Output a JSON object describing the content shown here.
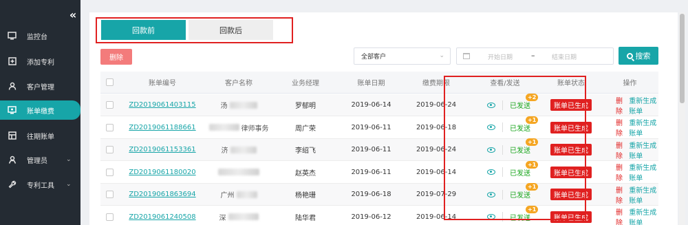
{
  "sidebar": {
    "collapse_icon": "double-chevron-left-icon",
    "items": [
      {
        "label": "监控台",
        "icon": "monitor-icon",
        "active": false,
        "has_children": false
      },
      {
        "label": "添加专利",
        "icon": "plus-square-icon",
        "active": false,
        "has_children": false
      },
      {
        "label": "客户管理",
        "icon": "user-icon",
        "active": false,
        "has_children": false
      },
      {
        "label": "账单缴费",
        "icon": "bill-icon",
        "active": true,
        "has_children": false
      },
      {
        "label": "往期账单",
        "icon": "history-icon",
        "active": false,
        "has_children": false
      },
      {
        "label": "管理员",
        "icon": "admin-icon",
        "active": false,
        "has_children": true
      },
      {
        "label": "专利工具",
        "icon": "wrench-icon",
        "active": false,
        "has_children": true
      }
    ]
  },
  "tabs": [
    {
      "label": "回款前",
      "active": true
    },
    {
      "label": "回款后",
      "active": false
    }
  ],
  "toolbar": {
    "delete_label": "删除",
    "customer_select_value": "全部客户",
    "start_date_placeholder": "开始日期",
    "date_separator": "–",
    "end_date_placeholder": "结束日期",
    "search_label": "搜索"
  },
  "table": {
    "headers": [
      "账单编号",
      "客户名称",
      "业务经理",
      "账单日期",
      "缴费期限",
      "查看/发送",
      "账单状态",
      "操作"
    ],
    "rows": [
      {
        "bill_no": "ZD2019061403115",
        "customer": "汤",
        "manager": "罗郁明",
        "bill_date": "2019-06-14",
        "deadline": "2019-06-24",
        "sent": "已发送",
        "sent_count": "+2",
        "status": "账单已生成"
      },
      {
        "bill_no": "ZD2019061188661",
        "customer": "律师事务",
        "manager": "周广荣",
        "bill_date": "2019-06-11",
        "deadline": "2019-06-18",
        "sent": "已发送",
        "sent_count": "+1",
        "status": "账单已生成"
      },
      {
        "bill_no": "ZD2019061153361",
        "customer": "济",
        "manager": "李绍飞",
        "bill_date": "2019-06-11",
        "deadline": "2019-06-24",
        "sent": "已发送",
        "sent_count": "+1",
        "status": "账单已生成"
      },
      {
        "bill_no": "ZD2019061180020",
        "customer": "",
        "manager": "赵英杰",
        "bill_date": "2019-06-11",
        "deadline": "2019-06-14",
        "sent": "已发送",
        "sent_count": "+1",
        "status": "账单已生成"
      },
      {
        "bill_no": "ZD2019061863694",
        "customer": "广州",
        "manager": "杨艳珊",
        "bill_date": "2019-06-18",
        "deadline": "2019-07-29",
        "sent": "已发送",
        "sent_count": "+1",
        "status": "账单已生成"
      },
      {
        "bill_no": "ZD2019061240508",
        "customer": "深",
        "manager": "陆华君",
        "bill_date": "2019-06-12",
        "deadline": "2019-06-14",
        "sent": "已发送",
        "sent_count": "+1",
        "status": "账单已生成"
      }
    ],
    "op_delete": "删除",
    "op_regenerate": "重新生成账单"
  },
  "colors": {
    "accent": "#17a5a8",
    "sidebar_bg": "#242b33",
    "danger": "#e02020",
    "sent_green": "#19a51c",
    "badge_orange": "#f5a623"
  }
}
